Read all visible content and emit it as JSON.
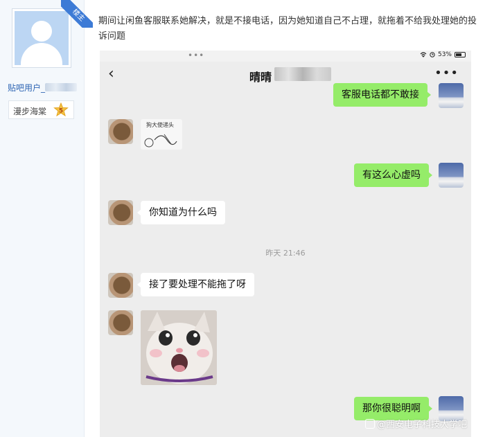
{
  "sidebar": {
    "ribbon_label": "楼主",
    "username": "贴吧用户_",
    "level_name": "漫步海棠",
    "level_number": "5"
  },
  "post": {
    "text": "期间让闲鱼客服联系她解决，就是不接电话，因为她知道自己不占理，就拖着不给我处理她的投诉问题"
  },
  "phone": {
    "status": {
      "dots": "•••",
      "battery_text": "53%"
    },
    "chat_title": "晴晴",
    "messages": [
      {
        "side": "right",
        "text": "客服电话都不敢接"
      },
      {
        "side": "left",
        "type": "sticker",
        "caption": "狗大使递头"
      },
      {
        "side": "right",
        "text": "有这么心虚吗"
      },
      {
        "side": "left",
        "text": "你知道为什么吗"
      },
      {
        "side": "left",
        "text": "接了要处理不能拖了呀"
      },
      {
        "side": "left",
        "type": "image"
      },
      {
        "side": "right",
        "text": "那你很聪明啊"
      }
    ],
    "timestamp": "昨天 21:46",
    "watermark": "@西安电子科技大学吧"
  },
  "colors": {
    "bubble_right": "#95ec69",
    "bubble_left": "#ffffff",
    "chat_bg": "#ededed",
    "username_link": "#2d64b3"
  }
}
